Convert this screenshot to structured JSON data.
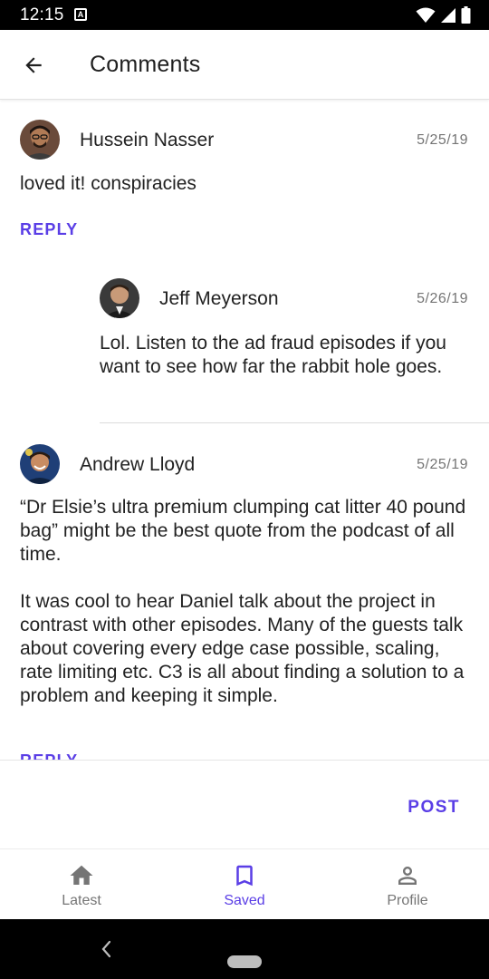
{
  "status_bar": {
    "time": "12:15",
    "notification_letter": "A"
  },
  "app_bar": {
    "title": "Comments"
  },
  "comments": [
    {
      "author": "Hussein Nasser",
      "date": "5/25/19",
      "text": "loved it! conspiracies",
      "reply_label": "REPLY"
    },
    {
      "author": "Jeff Meyerson",
      "date": "5/26/19",
      "text": "Lol. Listen to the ad fraud episodes if you want to see how far the rabbit hole goes."
    },
    {
      "author": "Andrew Lloyd",
      "date": "5/25/19",
      "text_p1": "“Dr Elsie’s ultra premium clumping cat litter 40 pound bag” might be the best quote from the podcast of all time.",
      "text_p2": "It was cool to hear Daniel talk about the project in contrast with other episodes. Many of the guests talk about covering every edge case possible, scaling, rate limiting etc. C3 is all about finding a solution to a problem and keeping it simple.",
      "reply_label": "REPLY"
    }
  ],
  "post_bar": {
    "post_label": "POST"
  },
  "bottom_nav": [
    {
      "label": "Latest",
      "icon": "home-icon",
      "active": false
    },
    {
      "label": "Saved",
      "icon": "bookmark-icon",
      "active": true
    },
    {
      "label": "Profile",
      "icon": "person-icon",
      "active": false
    }
  ],
  "colors": {
    "accent": "#5a3ee6",
    "muted": "#757575",
    "text": "#222222"
  }
}
